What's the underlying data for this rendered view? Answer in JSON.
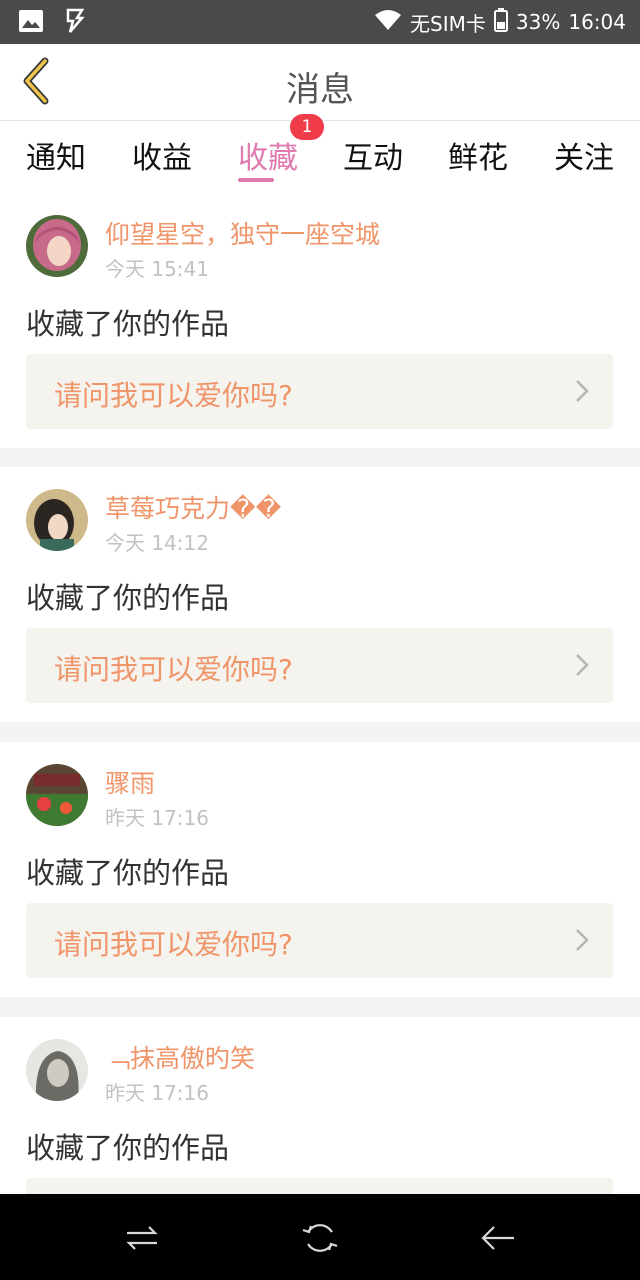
{
  "status_bar": {
    "carrier": "无SIM卡",
    "battery": "33%",
    "time": "16:04"
  },
  "header": {
    "title": "消息",
    "back_icon": "chevron-left-icon"
  },
  "tabs": [
    {
      "label": "通知"
    },
    {
      "label": "收益"
    },
    {
      "label": "收藏",
      "active": true,
      "badge": "1"
    },
    {
      "label": "互动"
    },
    {
      "label": "鲜花"
    },
    {
      "label": "关注"
    }
  ],
  "feed": [
    {
      "user": "仰望星空，独守一座空城",
      "time": "今天 15:41",
      "action": "收藏了你的作品",
      "quote": "请问我可以爱你吗?"
    },
    {
      "user": "草莓巧克力��",
      "time": "今天 14:12",
      "action": "收藏了你的作品",
      "quote": "请问我可以爱你吗?"
    },
    {
      "user": "骤雨",
      "time": "昨天 17:16",
      "action": "收藏了你的作品",
      "quote": "请问我可以爱你吗?"
    },
    {
      "user": "﹁抹高傲旳笑",
      "time": "昨天 17:16",
      "action": "收藏了你的作品",
      "quote": ""
    }
  ],
  "colors": {
    "accent": "#e07ab0",
    "name": "#f0956a",
    "badge": "#f03c4a"
  }
}
